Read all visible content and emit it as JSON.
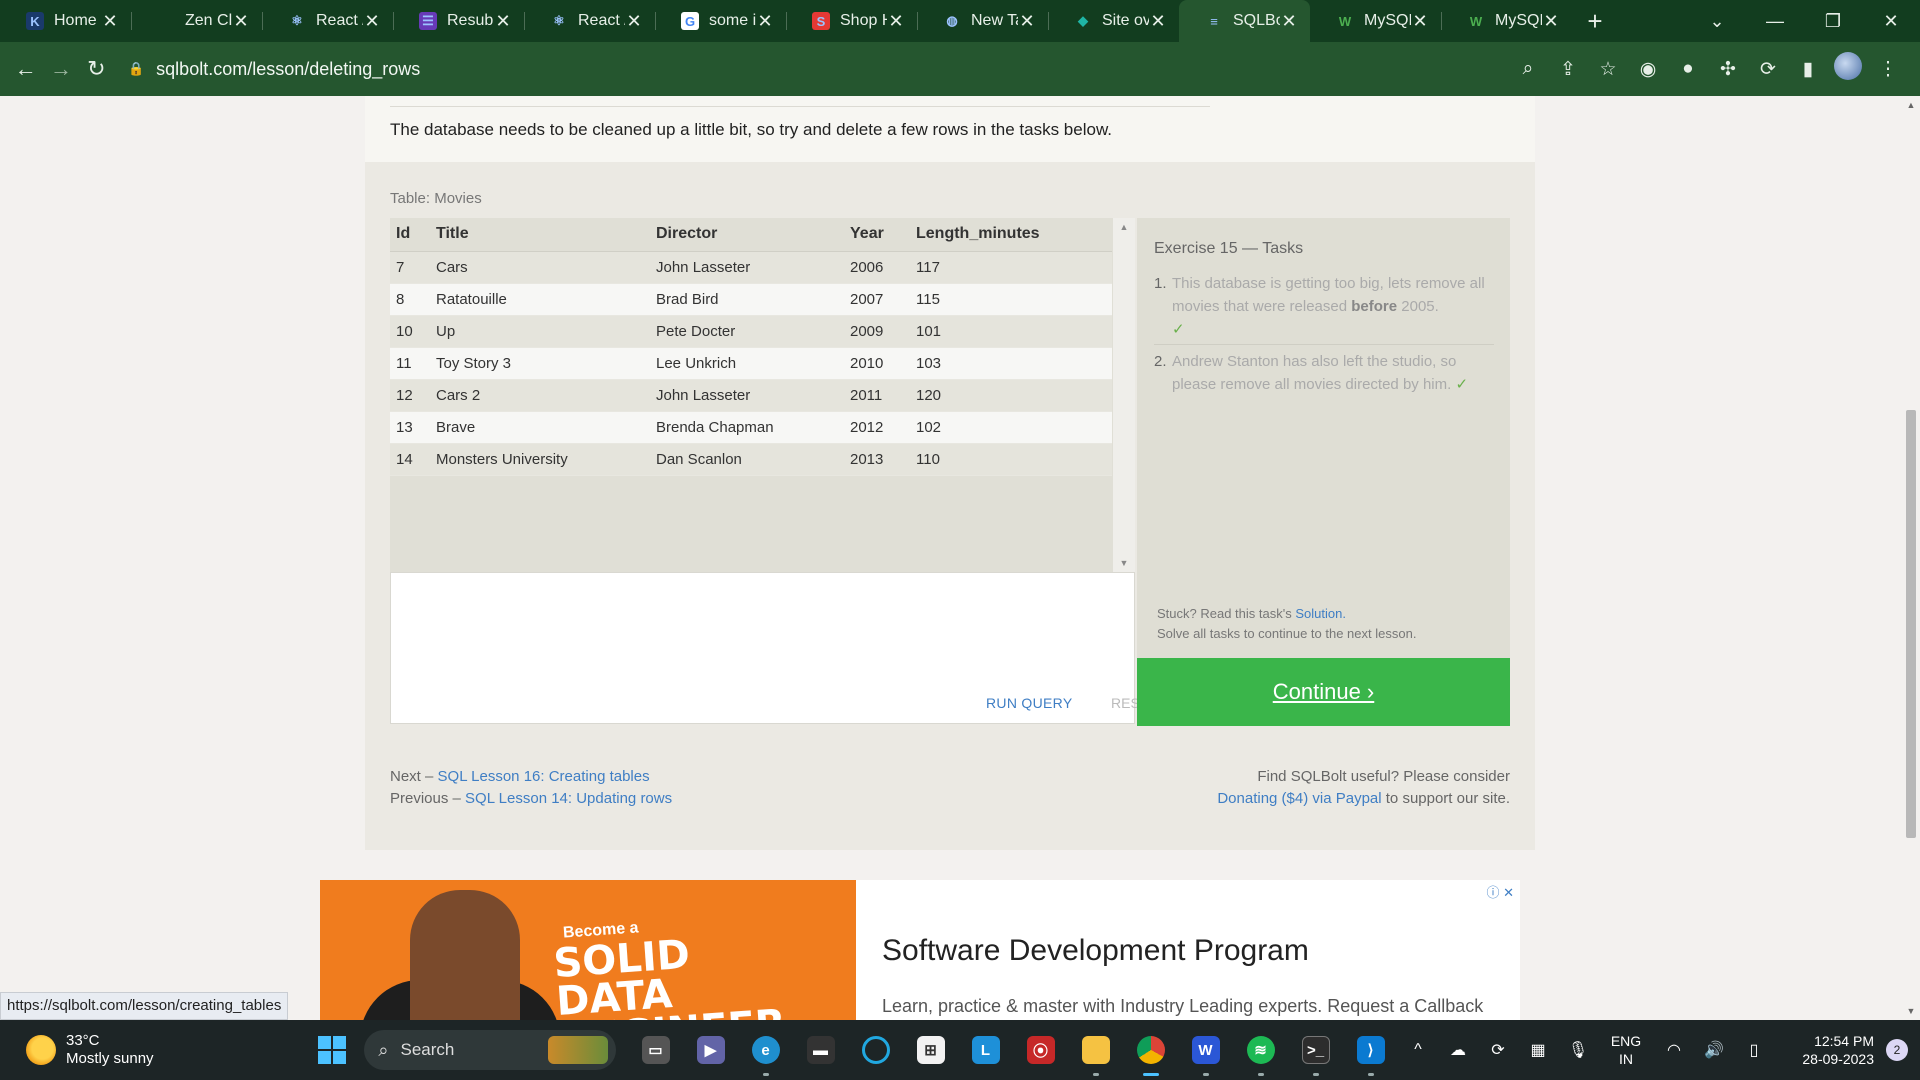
{
  "browser": {
    "tabs": [
      {
        "title": "Home",
        "icon": "k-logo-icon",
        "fav_text": "K",
        "fav_bg": "#1a3a6b",
        "active": false
      },
      {
        "title": "Zen Cl",
        "icon": "zen-icon",
        "fav_text": "",
        "fav_bg": "transparent",
        "active": false
      },
      {
        "title": "React /",
        "icon": "react-icon",
        "fav_text": "⚛",
        "fav_bg": "transparent",
        "active": false
      },
      {
        "title": "Resubr",
        "icon": "form-icon",
        "fav_text": "☰",
        "fav_bg": "#673ab7",
        "active": false
      },
      {
        "title": "React /",
        "icon": "react-icon",
        "fav_text": "⚛",
        "fav_bg": "transparent",
        "active": false
      },
      {
        "title": "some i",
        "icon": "google-icon",
        "fav_text": "G",
        "fav_bg": "#ffffff",
        "active": false
      },
      {
        "title": "Shop H",
        "icon": "shop-icon",
        "fav_text": "S",
        "fav_bg": "#e53935",
        "active": false
      },
      {
        "title": "New Ta",
        "icon": "globe-icon",
        "fav_text": "◍",
        "fav_bg": "transparent",
        "active": false
      },
      {
        "title": "Site ov",
        "icon": "diamond-icon",
        "fav_text": "◆",
        "fav_bg": "transparent",
        "active": false
      },
      {
        "title": "SQLBo",
        "icon": "database-icon",
        "fav_text": "≡",
        "fav_bg": "transparent",
        "active": true
      },
      {
        "title": "MySQL",
        "icon": "w3-icon",
        "fav_text": "W",
        "fav_bg": "transparent",
        "active": false
      },
      {
        "title": "MySQL",
        "icon": "w3-icon",
        "fav_text": "W",
        "fav_bg": "transparent",
        "active": false
      }
    ],
    "url": "sqlbolt.com/lesson/deleting_rows",
    "status_url": "https://sqlbolt.com/lesson/creating_tables"
  },
  "lesson": {
    "intro": "The database needs to be cleaned up a little bit, so try and delete a few rows in the tasks below.",
    "table_label": "Table: Movies",
    "columns": [
      "Id",
      "Title",
      "Director",
      "Year",
      "Length_minutes"
    ],
    "rows": [
      [
        "7",
        "Cars",
        "John Lasseter",
        "2006",
        "117"
      ],
      [
        "8",
        "Ratatouille",
        "Brad Bird",
        "2007",
        "115"
      ],
      [
        "10",
        "Up",
        "Pete Docter",
        "2009",
        "101"
      ],
      [
        "11",
        "Toy Story 3",
        "Lee Unkrich",
        "2010",
        "103"
      ],
      [
        "12",
        "Cars 2",
        "John Lasseter",
        "2011",
        "120"
      ],
      [
        "13",
        "Brave",
        "Brenda Chapman",
        "2012",
        "102"
      ],
      [
        "14",
        "Monsters University",
        "Dan Scanlon",
        "2013",
        "110"
      ]
    ],
    "run_label": "RUN QUERY",
    "reset_label": "RESET",
    "tasks_title": "Exercise 15 — Tasks",
    "task1_num": "1.",
    "task1_pre": "This database is getting too big, lets remove all movies that were released",
    "task1_bold": "before",
    "task1_post": "2005.",
    "task2_num": "2.",
    "task2_text": "Andrew Stanton has also left the studio, so please remove all movies directed by him.",
    "check": "✓",
    "stuck_pre": "Stuck? Read this task's",
    "stuck_link": "Solution.",
    "solve_text": "Solve all tasks to continue to the next lesson.",
    "continue_label": "Continue ›",
    "next_prefix": "Next –",
    "next_link": "SQL Lesson 16: Creating tables",
    "prev_prefix": "Previous –",
    "prev_link": "SQL Lesson 14: Updating rows",
    "donate_text": "Find SQLBolt useful? Please consider",
    "donate_link": "Donating ($4) via Paypal",
    "donate_post": "to support our site."
  },
  "ad": {
    "become": "Become a",
    "headline": "SOLID DATA ENGINEER",
    "title": "Software Development Program",
    "subtitle": "Learn, practice & master with Industry Leading experts. Request a Callback"
  },
  "taskbar": {
    "temp": "33°C",
    "weather": "Mostly sunny",
    "search": "Search",
    "lang1": "ENG",
    "lang2": "IN",
    "time": "12:54 PM",
    "date": "28-09-2023",
    "notifications": "2"
  },
  "colors": {
    "accent": "#3ab54a",
    "link": "#3f7ec4",
    "chrome": "#25562f"
  }
}
